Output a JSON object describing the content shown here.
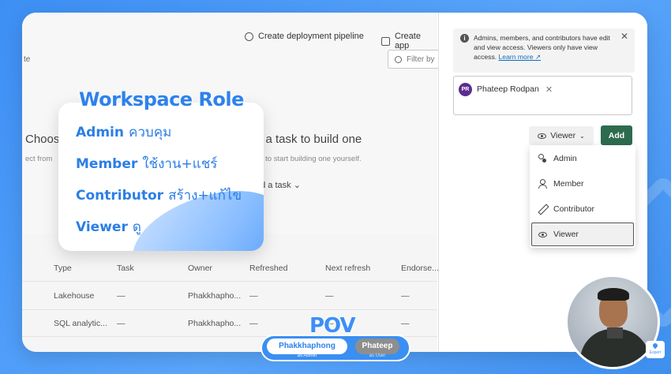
{
  "toolbar": {
    "pipeline_label": "Create deployment pipeline",
    "app_label": "Create app",
    "filter_placeholder": "Filter by"
  },
  "workspace": {
    "cut_left_header": "te",
    "choose_text": "Choos",
    "choose_sub": "ect from",
    "task_title": "d a task to build one",
    "task_sub": "sk to start building one yourself.",
    "add_task": "dd a task"
  },
  "table": {
    "headers": [
      "Type",
      "Task",
      "Owner",
      "Refreshed",
      "Next refresh",
      "Endorse..."
    ],
    "rows": [
      [
        "Lakehouse",
        "—",
        "Phakkhapho...",
        "—",
        "—",
        "—"
      ],
      [
        "SQL analytic...",
        "—",
        "Phakkhapho...",
        "—",
        "—",
        "—"
      ]
    ]
  },
  "overlay": {
    "title": "Workspace Role",
    "roles": [
      {
        "name": "Admin",
        "thai": "ควบคุม"
      },
      {
        "name": "Member",
        "thai": "ใช้งาน+แชร์"
      },
      {
        "name": "Contributor",
        "thai": "สร้าง+แก้ไข"
      },
      {
        "name": "Viewer",
        "thai": "ดู"
      }
    ]
  },
  "pane": {
    "info_text": "Admins, members, and contributors have edit and view access. Viewers only have view access.",
    "learn_more": "Learn more",
    "person_initials": "PR",
    "person_name": "Phateep Rodpan",
    "role_button": "Viewer",
    "add_button": "Add",
    "menu": [
      "Admin",
      "Member",
      "Contributor",
      "Viewer"
    ],
    "selected": "Viewer"
  },
  "pov": {
    "title": "POV",
    "a_name": "Phakkhaphong",
    "a_sub": "as Admin",
    "b_name": "Phateep",
    "b_sub": "as User"
  },
  "brand": {
    "expert_label": "Expert"
  },
  "colors": {
    "accent": "#3d8ff5",
    "add_button": "#2e6b4e"
  }
}
